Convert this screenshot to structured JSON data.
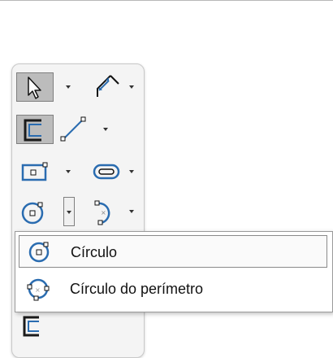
{
  "shortcut_bar": {
    "tools": [
      {
        "icon": "select-arrow-icon"
      },
      {
        "icon": "smart-dimension-icon"
      },
      {
        "icon": "sketch-icon"
      },
      {
        "icon": "line-icon"
      },
      {
        "icon": "rectangle-icon"
      },
      {
        "icon": "slot-icon"
      },
      {
        "icon": "circle-icon"
      },
      {
        "icon": "arc-icon"
      },
      {
        "icon": "exit-sketch-icon"
      }
    ]
  },
  "flyout_menu": {
    "items": [
      {
        "label": "Círculo",
        "icon": "circle-icon",
        "selected": true
      },
      {
        "label": "Círculo do perímetro",
        "icon": "perimeter-circle-icon",
        "selected": false
      }
    ]
  },
  "colors": {
    "accent": "#2a6cb0",
    "pressed_bg": "#bcbcbc",
    "bar_bg": "#f4f4f4"
  }
}
